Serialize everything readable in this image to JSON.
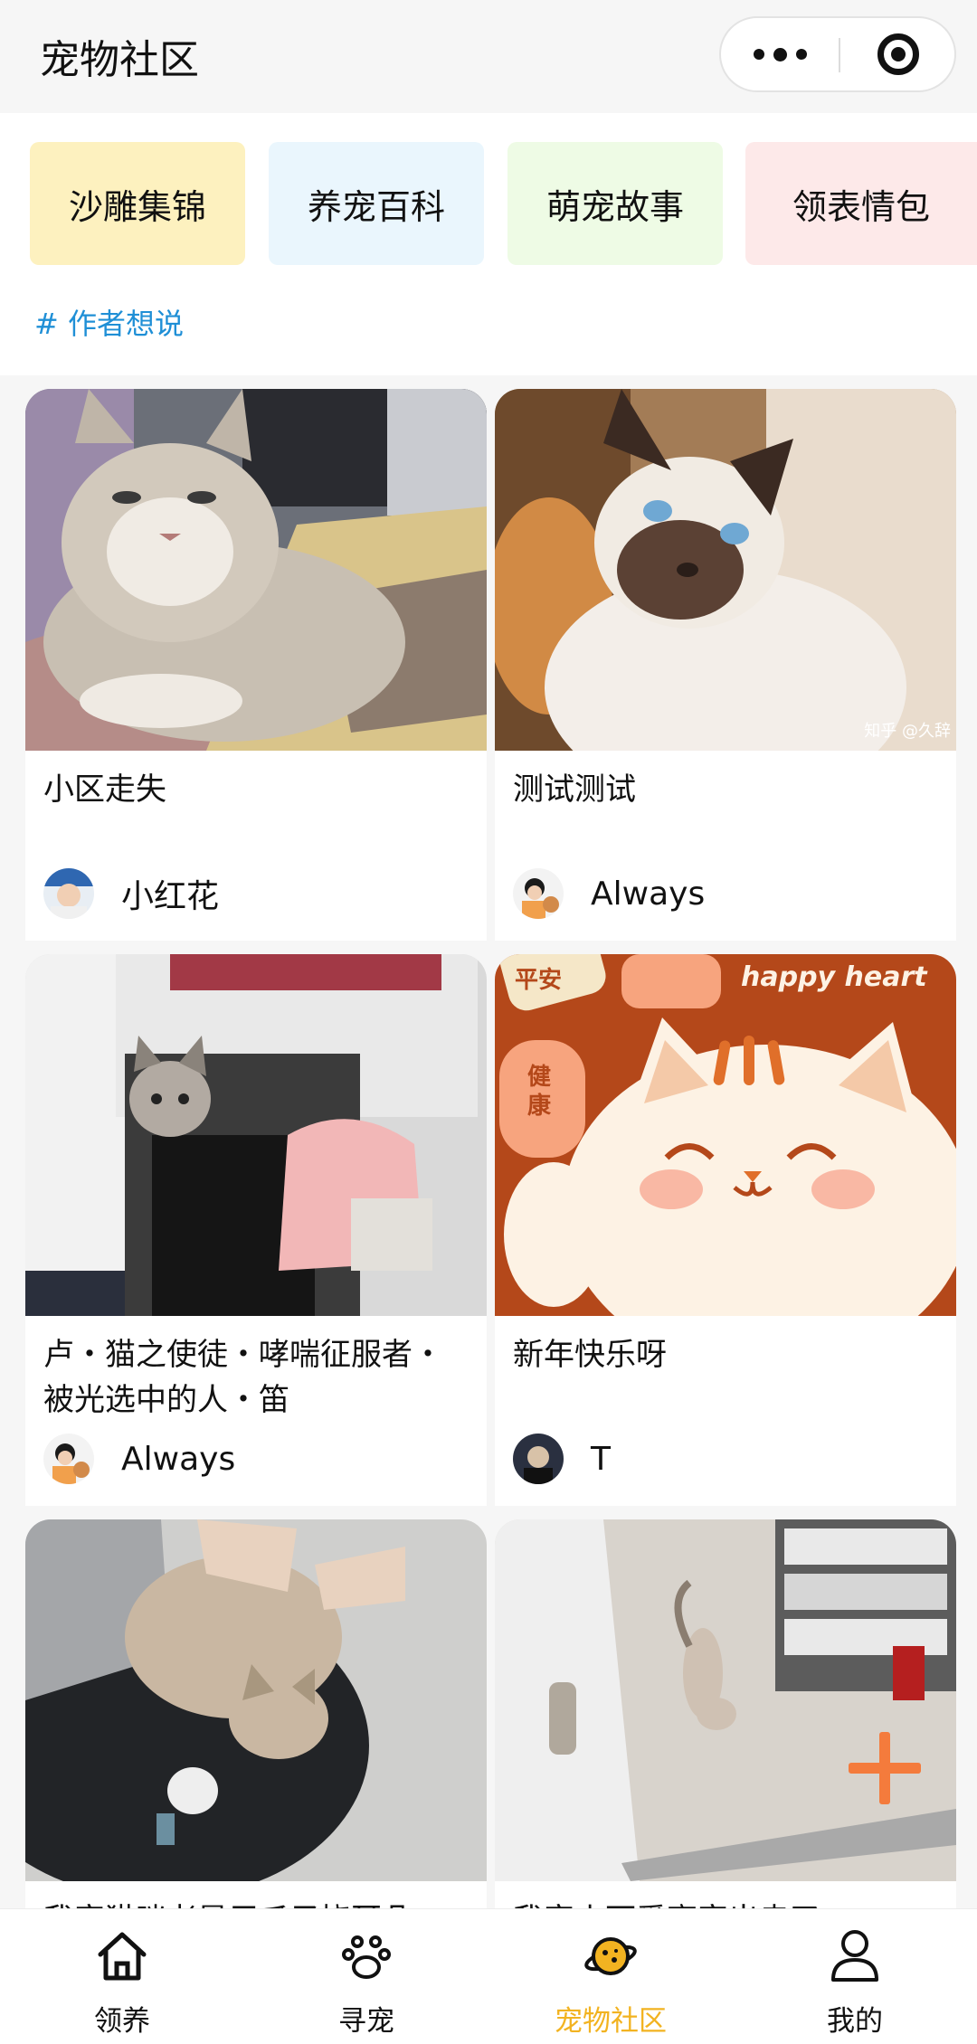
{
  "header": {
    "title": "宠物社区"
  },
  "categories": [
    {
      "label": "沙雕集锦"
    },
    {
      "label": "养宠百科"
    },
    {
      "label": "萌宠故事"
    },
    {
      "label": "领表情包"
    }
  ],
  "author_link": "# 作者想说",
  "posts": [
    {
      "title": "小区走失",
      "author": "小红花"
    },
    {
      "title": "测试测试",
      "author": "Always"
    },
    {
      "title": "卢・猫之使徒・哮喘征服者・被光选中的人・笛",
      "author": "Always"
    },
    {
      "title": "新年快乐呀",
      "author": "T"
    },
    {
      "title": "我家猫咪老是用爪子挠耳朵",
      "author": ""
    },
    {
      "title": "我家小可爱离家出走了",
      "author": ""
    }
  ],
  "image_text": {
    "watermark": "知乎 @久辞",
    "card4_banner": "happy heart",
    "card4_tag1": "平安",
    "card4_tag2": "健康"
  },
  "tabbar": {
    "items": [
      {
        "label": "领养",
        "icon": "home-icon"
      },
      {
        "label": "寻宠",
        "icon": "paw-icon"
      },
      {
        "label": "宠物社区",
        "icon": "planet-icon",
        "active": true
      },
      {
        "label": "我的",
        "icon": "user-icon"
      }
    ]
  },
  "colors": {
    "accent": "#f2b321",
    "link": "#1f8fd6",
    "fab": "#f47b3c"
  }
}
